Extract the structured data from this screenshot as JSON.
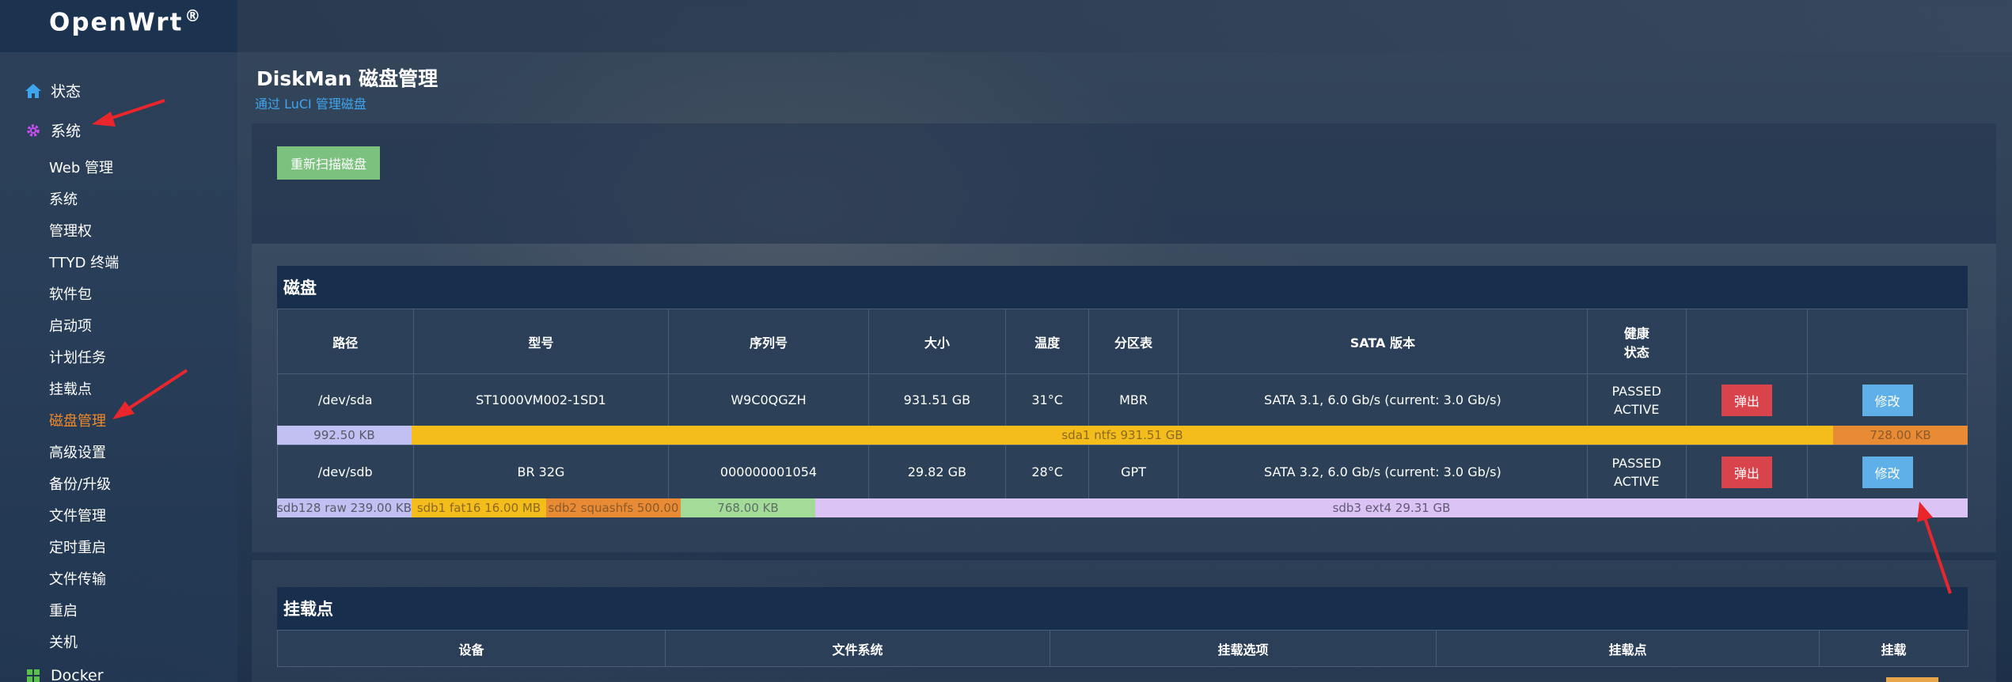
{
  "brand": {
    "name": "OpenWrt",
    "reg": "®"
  },
  "sidebar": {
    "status_label": "状态",
    "system_label": "系统",
    "docker_label": "Docker",
    "items": [
      {
        "label": "Web 管理"
      },
      {
        "label": "系统"
      },
      {
        "label": "管理权"
      },
      {
        "label": "TTYD 终端"
      },
      {
        "label": "软件包"
      },
      {
        "label": "启动项"
      },
      {
        "label": "计划任务"
      },
      {
        "label": "挂载点"
      },
      {
        "label": "磁盘管理",
        "active": true
      },
      {
        "label": "高级设置"
      },
      {
        "label": "备份/升级"
      },
      {
        "label": "文件管理"
      },
      {
        "label": "定时重启"
      },
      {
        "label": "文件传输"
      },
      {
        "label": "重启"
      },
      {
        "label": "关机"
      }
    ]
  },
  "page": {
    "title": "DiskMan 磁盘管理",
    "description": "通过 LuCI 管理磁盘",
    "rescan_label": "重新扫描磁盘"
  },
  "disks": {
    "section_title": "磁盘",
    "headers": {
      "path": "路径",
      "model": "型号",
      "serial": "序列号",
      "size": "大小",
      "temp": "温度",
      "ptable": "分区表",
      "sata": "SATA 版本",
      "health_line1": "健康",
      "health_line2": "状态"
    },
    "eject_label": "弹出",
    "edit_label": "修改",
    "rows": [
      {
        "path": "/dev/sda",
        "model": "ST1000VM002-1SD1",
        "serial": "W9C0QGZH",
        "size": "931.51 GB",
        "temp": "31°C",
        "ptable": "MBR",
        "sata": "SATA 3.1, 6.0 Gb/s (current: 3.0 Gb/s)",
        "health": "PASSED",
        "state": "ACTIVE",
        "partitions": [
          {
            "label": "992.50 KB",
            "color": "#c2c0f2",
            "text": "#555a66"
          },
          {
            "label": "sda1 ntfs 931.51 GB",
            "color": "#f5bd1b",
            "text": "#8a6a20"
          },
          {
            "label": "728.00 KB",
            "color": "#e98b34",
            "text": "#8a5a2a"
          }
        ]
      },
      {
        "path": "/dev/sdb",
        "model": "BR 32G",
        "serial": "000000001054",
        "size": "29.82 GB",
        "temp": "28°C",
        "ptable": "GPT",
        "sata": "SATA 3.2, 6.0 Gb/s (current: 3.0 Gb/s)",
        "health": "PASSED",
        "state": "ACTIVE",
        "partitions": [
          {
            "label": "sdb128 raw 239.00 KB",
            "color": "#c2c0f2",
            "text": "#555a66"
          },
          {
            "label": "sdb1 fat16 16.00 MB",
            "color": "#f5bd1b",
            "text": "#8a6a20"
          },
          {
            "label": "sdb2 squashfs 500.00",
            "color": "#e98b34",
            "text": "#8a5a2a"
          },
          {
            "label": "768.00 KB",
            "color": "#a3dc98",
            "text": "#5f6e66"
          },
          {
            "label": "sdb3 ext4 29.31 GB",
            "color": "#dcc3f5",
            "text": "#5f5a73"
          }
        ]
      }
    ]
  },
  "mounts": {
    "section_title": "挂载点",
    "headers": {
      "device": "设备",
      "fs": "文件系统",
      "options": "挂载选项",
      "mountpoint": "挂载点",
      "action": "挂载"
    }
  },
  "colors": {
    "accent_active": "#f0892a",
    "link": "#3ea6f0",
    "eject": "#d9444c",
    "edit": "#5fb0e8",
    "rescan": "#7cc17e",
    "annotation_arrow": "#e8262c"
  }
}
